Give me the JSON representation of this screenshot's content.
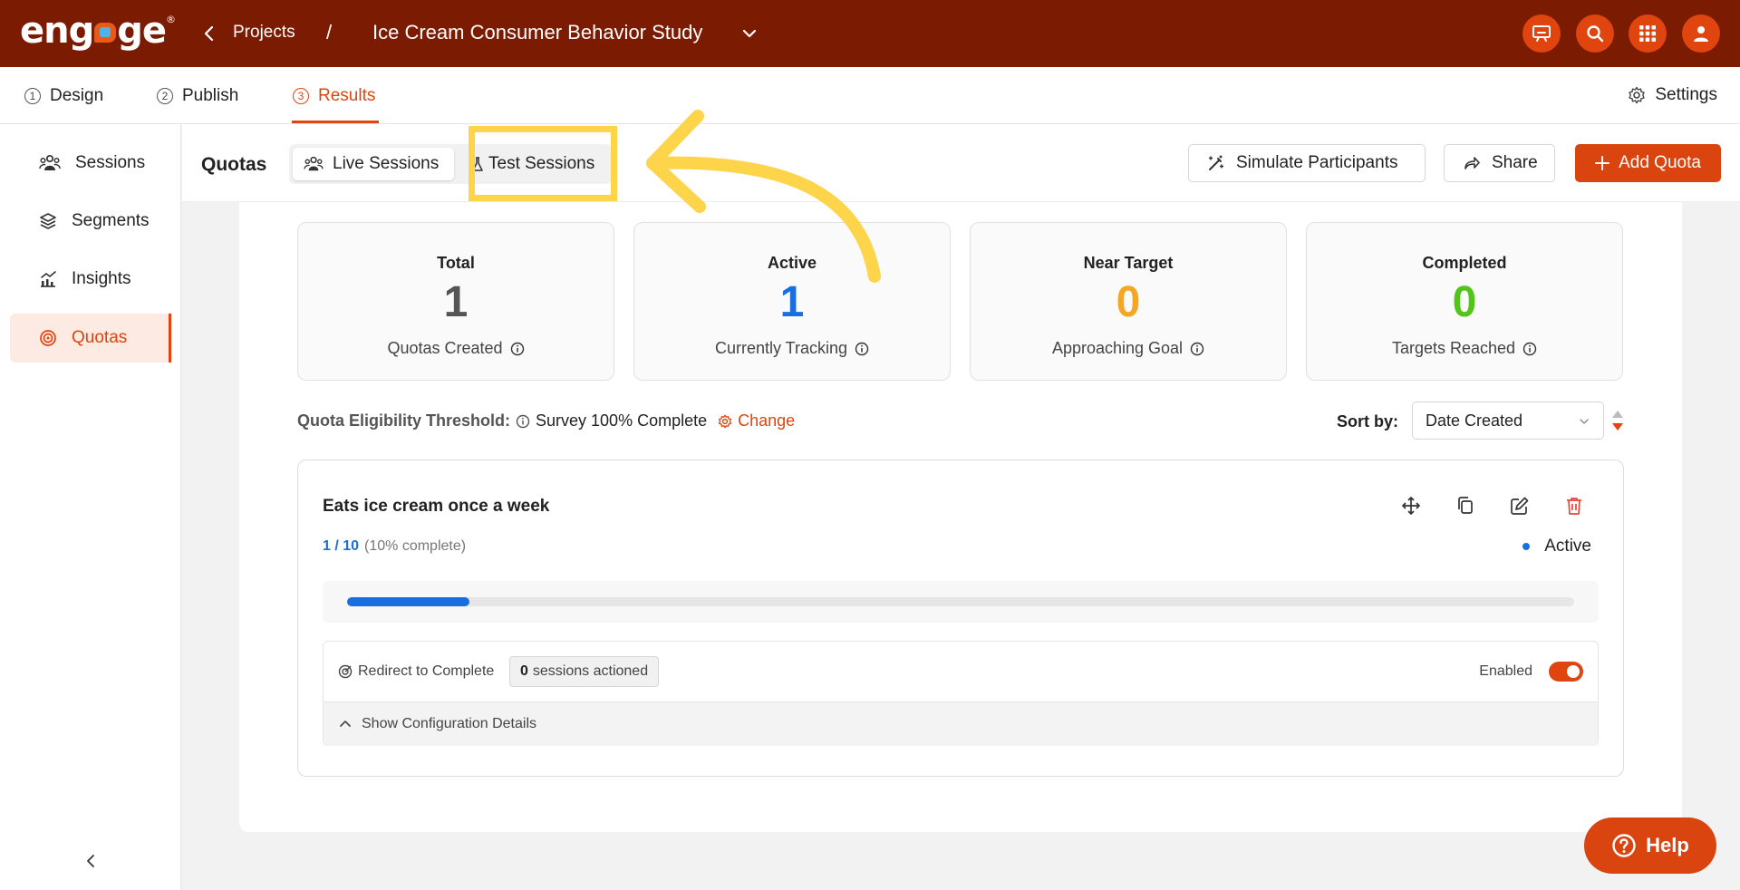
{
  "brand": {
    "name": "engage"
  },
  "breadcrumb": {
    "projects": "Projects",
    "separator": "/",
    "title": "Ice Cream Consumer Behavior Study"
  },
  "steps": [
    {
      "num": "1",
      "label": "Design"
    },
    {
      "num": "2",
      "label": "Publish"
    },
    {
      "num": "3",
      "label": "Results"
    }
  ],
  "settings_label": "Settings",
  "sidebar": {
    "items": [
      {
        "label": "Sessions",
        "icon": "users-icon"
      },
      {
        "label": "Segments",
        "icon": "layers-icon"
      },
      {
        "label": "Insights",
        "icon": "chart-icon"
      },
      {
        "label": "Quotas",
        "icon": "target-icon"
      }
    ]
  },
  "header": {
    "title": "Quotas",
    "tabs": {
      "live": "Live Sessions",
      "test": "Test Sessions"
    },
    "simulate": "Simulate Participants",
    "share": "Share",
    "add_quota": "Add Quota"
  },
  "stats": [
    {
      "label": "Total",
      "value": "1",
      "sub": "Quotas Created",
      "color": "#555555"
    },
    {
      "label": "Active",
      "value": "1",
      "sub": "Currently Tracking",
      "color": "#1a6fe0"
    },
    {
      "label": "Near Target",
      "value": "0",
      "sub": "Approaching Goal",
      "color": "#f5a623"
    },
    {
      "label": "Completed",
      "value": "0",
      "sub": "Targets Reached",
      "color": "#52c41a"
    }
  ],
  "threshold": {
    "label": "Quota Eligibility Threshold:",
    "value": "Survey 100% Complete",
    "change": "Change"
  },
  "sort": {
    "label": "Sort by:",
    "value": "Date Created"
  },
  "quota": {
    "title": "Eats ice cream once a week",
    "fraction": "1 / 10",
    "percent_text": "(10% complete)",
    "progress": 0.1,
    "status": "Active",
    "redirect": "Redirect to Complete",
    "sessions_count": "0",
    "sessions_text": "sessions actioned",
    "enabled": "Enabled",
    "config": "Show Configuration Details"
  },
  "help": "Help",
  "colors": {
    "brand_dark": "#7a1b02",
    "accent": "#e0440f",
    "highlight": "#fdd44a"
  }
}
